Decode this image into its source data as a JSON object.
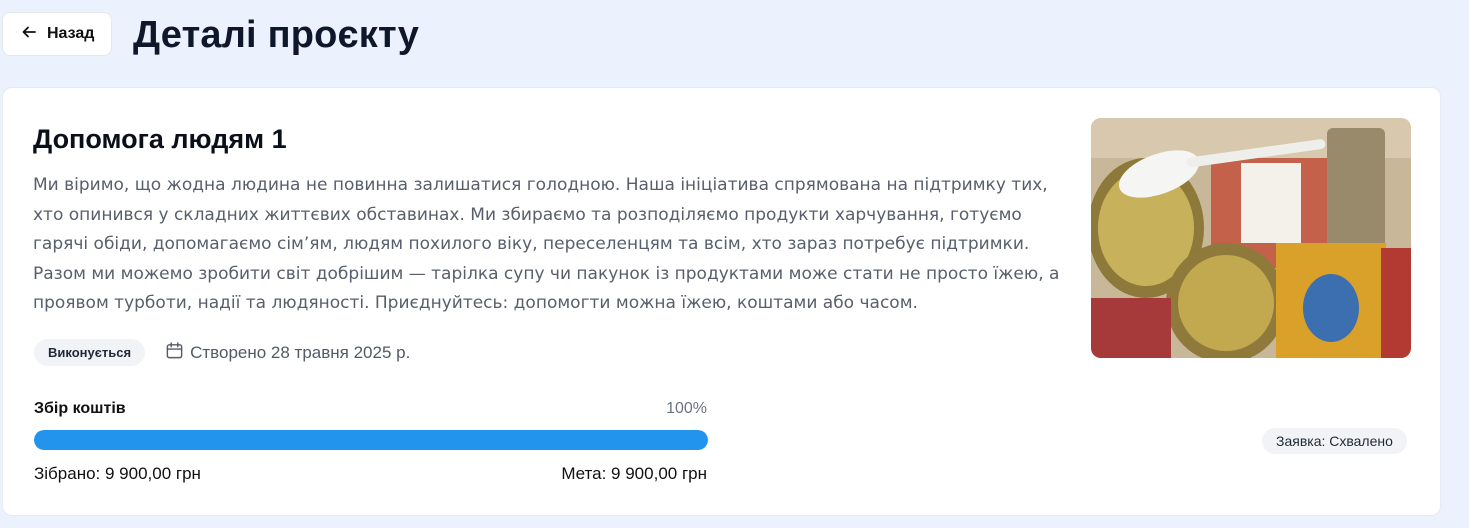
{
  "header": {
    "back_label": "Назад",
    "title": "Деталі проєкту"
  },
  "project": {
    "title": "Допомога людям 1",
    "description": "Ми віримо, що жодна людина не повинна залишатися голодною. Наша ініціатива спрямована на підтримку тих, хто опинився у складних життєвих обставинах. Ми збираємо та розподіляємо продукти харчування, готуємо гарячі обіди, допомагаємо сім’ям, людям похилого віку, переселенцям та всім, хто зараз потребує підтримки. Разом ми можемо зробити світ добрішим — тарілка супу чи пакунок із продуктами може стати не просто їжею, а проявом турботи, надії та людяності. Приєднуйтесь: допомогти можна їжею, коштами або часом.",
    "status": "Виконується",
    "created": "Створено 28 травня 2025 р.",
    "image_icon": "food-package-photo"
  },
  "funding": {
    "label": "Збір коштів",
    "percent_label": "100%",
    "progress_fraction": 1.0,
    "collected": "Зібрано: 9 900,00 грн",
    "goal": "Мета: 9 900,00 грн"
  },
  "application": {
    "status": "Заявка: Схвалено"
  },
  "colors": {
    "page_bg": "#ebf1fd",
    "progress": "#2294ee",
    "badge_bg": "#f1f3f6"
  },
  "icons": {
    "back": "arrow-left-icon",
    "calendar": "calendar-icon"
  }
}
